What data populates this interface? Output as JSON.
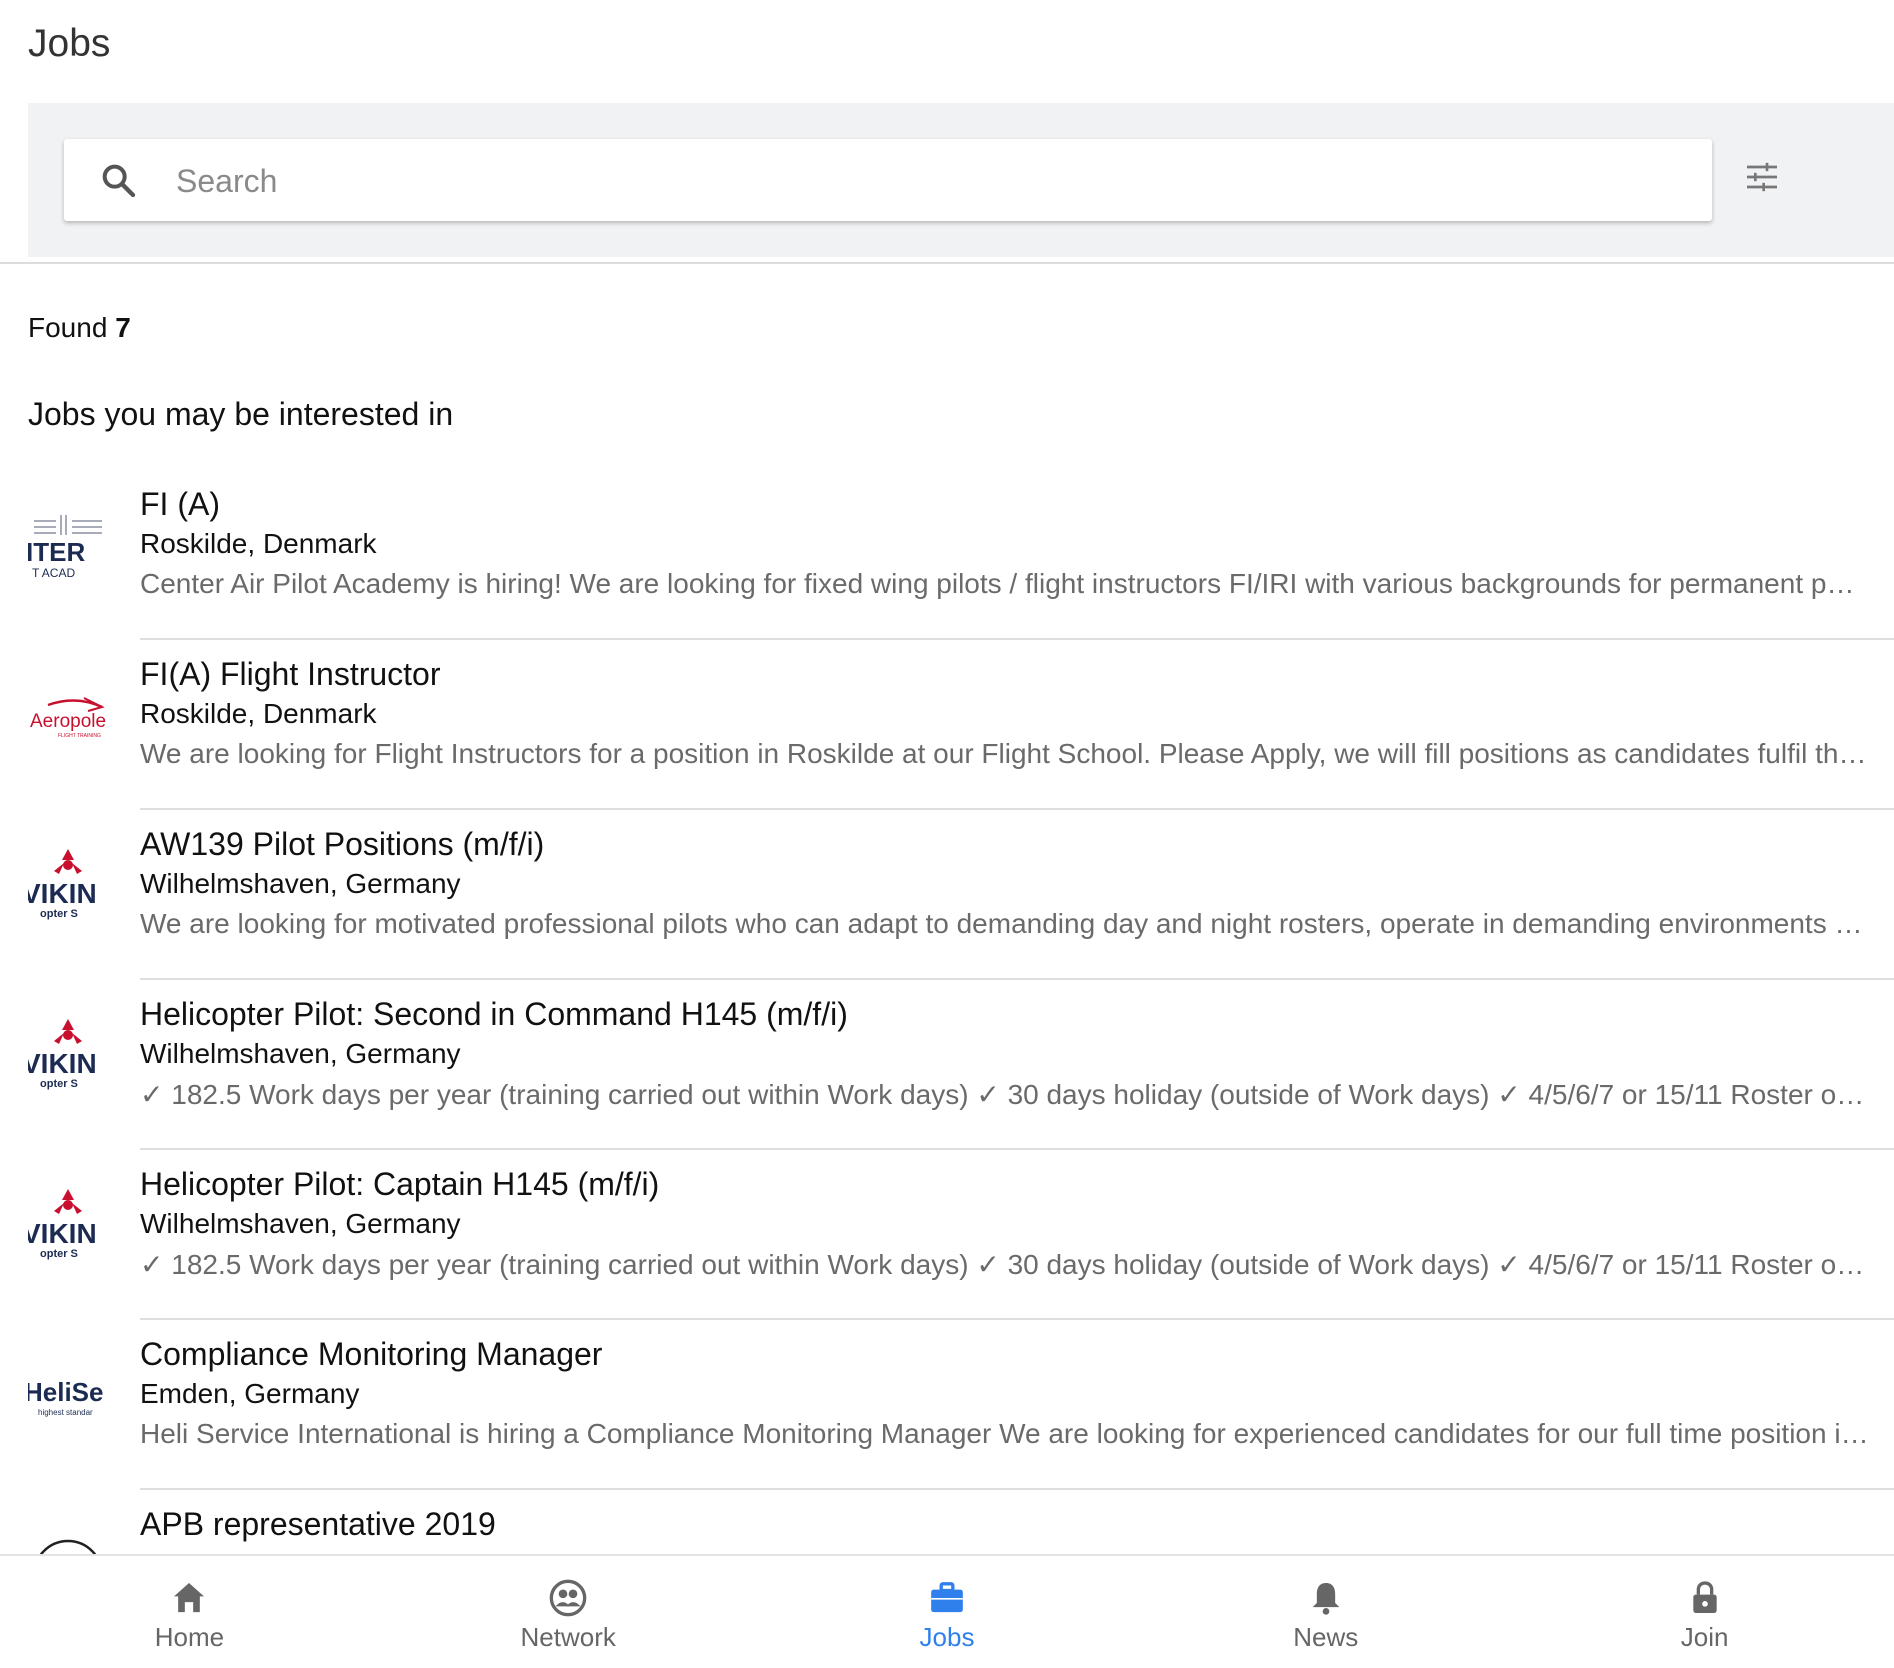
{
  "header": {
    "title": "Jobs"
  },
  "search": {
    "placeholder": "Search",
    "value": "",
    "icon": "search-icon",
    "filter_icon": "tune-icon"
  },
  "results": {
    "found_label": "Found",
    "found_count": "7"
  },
  "section": {
    "title": "Jobs you may be interested in"
  },
  "jobs": [
    {
      "title": "FI (A)",
      "location": "Roskilde, Denmark",
      "description": "Center Air Pilot Academy is hiring! We are looking for fixed wing pilots / flight instructors FI/IRI with various backgrounds for permanent positions",
      "logo": {
        "line1": "ITER",
        "line2": "T ACAD",
        "color": "#1c2b52"
      }
    },
    {
      "title": "FI(A) Flight Instructor",
      "location": "Roskilde, Denmark",
      "description": "We are looking for Flight Instructors for a position in Roskilde at our Flight School. Please Apply, we will fill positions as candidates fulfil the requirements",
      "logo": {
        "line1": "Aeropole",
        "line2": "FLIGHT TRAINING",
        "color": "#c8102e"
      }
    },
    {
      "title": "AW139 Pilot Positions (m/f/i)",
      "location": "Wilhelmshaven, Germany",
      "description": "We are looking for motivated professional pilots who can adapt to demanding day and night rosters, operate in demanding environments offshore",
      "logo": {
        "line1": "VIKIN",
        "line2": "opter S",
        "color": "#1c2b52",
        "accent": "#c8102e"
      }
    },
    {
      "title": "Helicopter Pilot: Second in Command H145 (m/f/i)",
      "location": "Wilhelmshaven, Germany",
      "description": "✓ 182.5 Work days per year (training carried out within Work days) ✓ 30 days holiday (outside of Work days) ✓ 4/5/6/7 or 15/11 Roster options available",
      "logo": {
        "line1": "VIKIN",
        "line2": "opter S",
        "color": "#1c2b52",
        "accent": "#c8102e"
      }
    },
    {
      "title": "Helicopter Pilot: Captain H145 (m/f/i)",
      "location": "Wilhelmshaven, Germany",
      "description": "✓ 182.5 Work days per year (training carried out within Work days) ✓ 30 days holiday (outside of Work days) ✓ 4/5/6/7 or 15/11 Roster options available",
      "logo": {
        "line1": "VIKIN",
        "line2": "opter S",
        "color": "#1c2b52",
        "accent": "#c8102e"
      }
    },
    {
      "title": "Compliance Monitoring Manager",
      "location": "Emden, Germany",
      "description": "Heli Service International is hiring a Compliance Monitoring Manager We are looking for experienced candidates for our full time position in Emden",
      "logo": {
        "line1": "HeliSe",
        "line2": "highest standar",
        "color": "#1c2b52"
      }
    },
    {
      "title": "APB representative 2019",
      "location": "",
      "description": "",
      "logo": {
        "line1": "",
        "line2": "",
        "color": "#222"
      }
    }
  ],
  "nav": {
    "items": [
      {
        "label": "Home",
        "icon": "home-icon",
        "active": false
      },
      {
        "label": "Network",
        "icon": "network-icon",
        "active": false
      },
      {
        "label": "Jobs",
        "icon": "briefcase-icon",
        "active": true
      },
      {
        "label": "News",
        "icon": "bell-icon",
        "active": false
      },
      {
        "label": "Join",
        "icon": "lock-icon",
        "active": false
      }
    ],
    "active_color": "#2f80ed",
    "inactive_color": "#666666"
  }
}
